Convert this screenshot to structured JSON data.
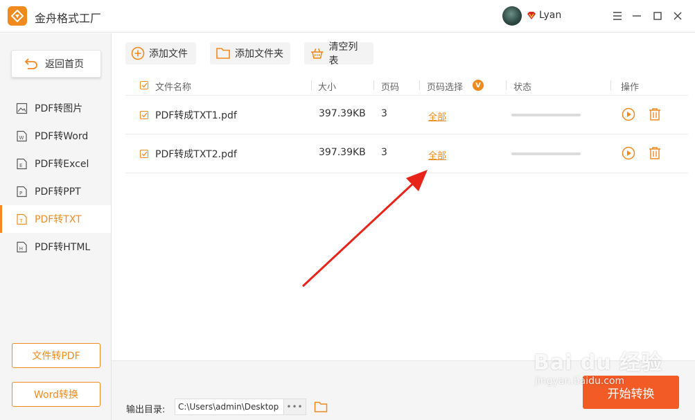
{
  "app": {
    "title": "金舟格式工厂"
  },
  "user": {
    "name": "Lyan"
  },
  "sidebar": {
    "home_label": "返回首页",
    "items": [
      {
        "label": "PDF转图片",
        "icon": "image-file-icon"
      },
      {
        "label": "PDF转Word",
        "icon": "word-file-icon"
      },
      {
        "label": "PDF转Excel",
        "icon": "excel-file-icon"
      },
      {
        "label": "PDF转PPT",
        "icon": "ppt-file-icon"
      },
      {
        "label": "PDF转TXT",
        "icon": "txt-file-icon",
        "active": true
      },
      {
        "label": "PDF转HTML",
        "icon": "html-file-icon"
      }
    ],
    "bottom_buttons": [
      "文件转PDF",
      "Word转换"
    ]
  },
  "toolbar": {
    "add_file": "添加文件",
    "add_folder": "添加文件夹",
    "clear_list": "清空列表"
  },
  "table": {
    "headers": {
      "name": "文件名称",
      "size": "大小",
      "pages": "页码",
      "page_select": "页码选择",
      "page_select_badge": "V",
      "status": "状态",
      "actions": "操作"
    },
    "rows": [
      {
        "name": "PDF转成TXT1.pdf",
        "size": "397.39KB",
        "pages": "3",
        "page_select": "全部",
        "progress": 0
      },
      {
        "name": "PDF转成TXT2.pdf",
        "size": "397.39KB",
        "pages": "3",
        "page_select": "全部",
        "progress": 0
      }
    ]
  },
  "output": {
    "label": "输出目录:",
    "path": "C:\\Users\\admin\\Desktop",
    "more": "•••"
  },
  "start_button": "开始转换",
  "watermark": {
    "main": "Bai du 经验",
    "sub": "jingyan.baidu.com"
  },
  "colors": {
    "accent": "#f08a1d",
    "start": "#f25a26",
    "arrow": "#e8231a"
  }
}
